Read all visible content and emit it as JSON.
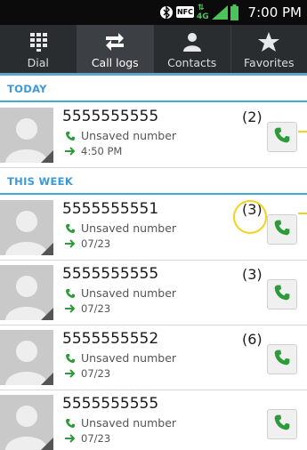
{
  "status_bar": {
    "time": "7:00 PM",
    "nfc_label": "NFC",
    "network_label": "4G"
  },
  "tabs": [
    {
      "label": "Dial",
      "icon": "dialpad-icon",
      "active": false
    },
    {
      "label": "Call logs",
      "icon": "swap-arrows-icon",
      "active": true
    },
    {
      "label": "Contacts",
      "icon": "person-icon",
      "active": false
    },
    {
      "label": "Favorites",
      "icon": "star-icon",
      "active": false
    }
  ],
  "sections": [
    {
      "title": "TODAY"
    },
    {
      "title": "THIS WEEK"
    }
  ],
  "entries": [
    {
      "number": "5555555555",
      "label": "Unsaved number",
      "detail": "4:50 PM",
      "count": "(2)"
    },
    {
      "number": "5555555551",
      "label": "Unsaved number",
      "detail": "07/23",
      "count": "(3)"
    },
    {
      "number": "5555555555",
      "label": "Unsaved number",
      "detail": "07/23",
      "count": "(3)"
    },
    {
      "number": "5555555552",
      "label": "Unsaved number",
      "detail": "07/23",
      "count": "(6)"
    },
    {
      "number": "5555555555",
      "label": "Unsaved number",
      "detail": "07/23",
      "count": ""
    }
  ],
  "colors": {
    "accent": "#3d9ad6",
    "call_green": "#2e9b3a",
    "highlight": "#f3d21b",
    "tab_bg": "#2a2d30"
  }
}
